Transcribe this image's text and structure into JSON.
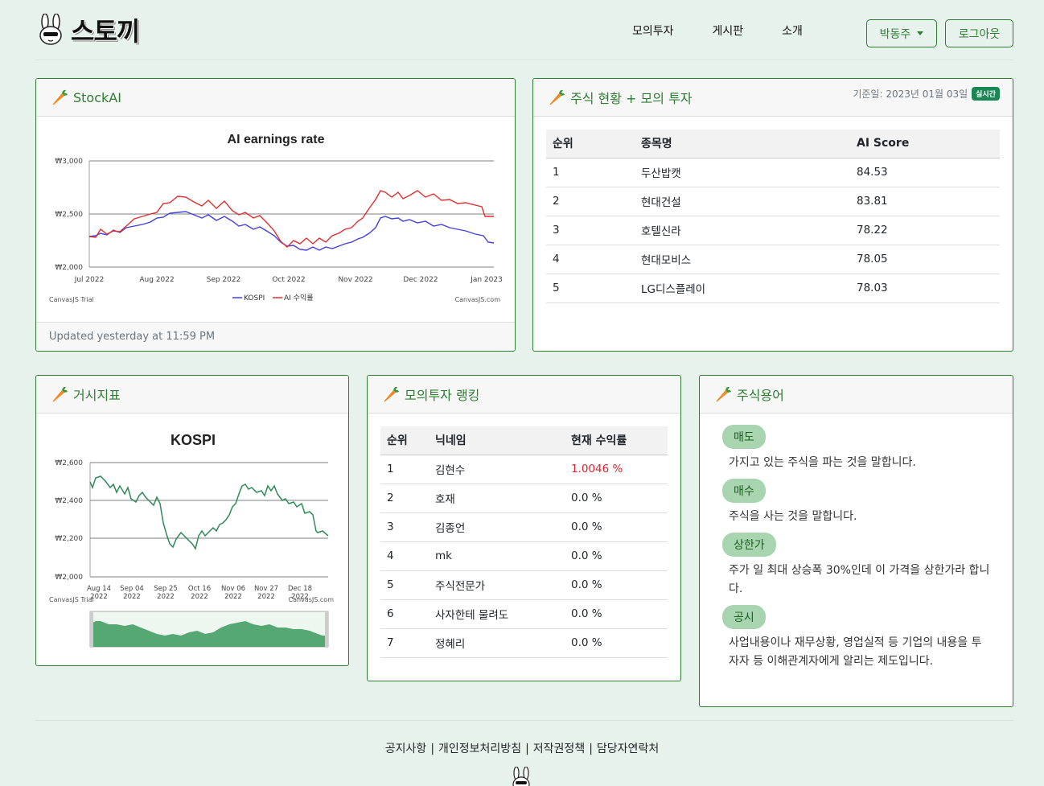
{
  "brand": {
    "name": "스토끼"
  },
  "nav": {
    "links": [
      "모의투자",
      "게시판",
      "소개"
    ],
    "user": "박동주",
    "logout": "로그아웃"
  },
  "stockai": {
    "title": "StockAI",
    "footer": "Updated yesterday at 11:59 PM",
    "chart": {
      "title": "AI earnings rate",
      "y_ticks": [
        "₩3,000",
        "₩2,500",
        "₩2,000"
      ],
      "x_ticks": [
        "Jul 2022",
        "Aug 2022",
        "Sep 2022",
        "Oct 2022",
        "Nov 2022",
        "Dec 2022",
        "Jan 2023"
      ],
      "legend": [
        "KOSPI",
        "AI 수익률"
      ],
      "credit_left": "CanvasJS Trial",
      "credit_right": "CanvasJS.com"
    }
  },
  "stocks": {
    "title": "주식 현황 + 모의 투자",
    "basis": "기준일: 2023년 01월 03일",
    "badge": "실시간",
    "headers": [
      "순위",
      "종목명",
      "AI Score"
    ],
    "rows": [
      [
        "1",
        "두산밥캣",
        "84.53"
      ],
      [
        "2",
        "현대건설",
        "83.81"
      ],
      [
        "3",
        "호텔신라",
        "78.22"
      ],
      [
        "4",
        "현대모비스",
        "78.05"
      ],
      [
        "5",
        "LG디스플레이",
        "78.03"
      ]
    ]
  },
  "macro": {
    "title": "거시지표",
    "chart": {
      "title": "KOSPI",
      "y_ticks": [
        "₩2,600",
        "₩2,400",
        "₩2,200",
        "₩2,000"
      ],
      "x_ticks": [
        [
          "Aug 14",
          "2022"
        ],
        [
          "Sep 04",
          "2022"
        ],
        [
          "Sep 25",
          "2022"
        ],
        [
          "Oct 16",
          "2022"
        ],
        [
          "Nov 06",
          "2022"
        ],
        [
          "Nov 27",
          "2022"
        ],
        [
          "Dec 18",
          "2022"
        ]
      ],
      "credit_left": "CanvasJS Trial",
      "credit_right": "CanvasJS.com"
    }
  },
  "ranking": {
    "title": "모의투자 랭킹",
    "headers": [
      "순위",
      "닉네임",
      "현재 수익률"
    ],
    "rows": [
      [
        "1",
        "김현수",
        "1.0046 %"
      ],
      [
        "2",
        "호재",
        "0.0 %"
      ],
      [
        "3",
        "김종언",
        "0.0 %"
      ],
      [
        "4",
        "mk",
        "0.0 %"
      ],
      [
        "5",
        "주식전문가",
        "0.0 %"
      ],
      [
        "6",
        "사자한테 물려도",
        "0.0 %"
      ],
      [
        "7",
        "정혜리",
        "0.0 %"
      ]
    ]
  },
  "terms": {
    "title": "주식용어",
    "items": [
      {
        "term": "매도",
        "desc": "가지고 있는 주식을 파는 것을 말합니다."
      },
      {
        "term": "매수",
        "desc": "주식을 사는 것을 말합니다."
      },
      {
        "term": "상한가",
        "desc": "주가 일 최대 상승폭 30%인데 이 가격을 상한가라 합니다."
      },
      {
        "term": "공시",
        "desc": "사업내용이나 재무상황, 영업실적 등 기업의 내용을 투자자 등 이해관계자에게 알리는 제도입니다."
      }
    ]
  },
  "footer": {
    "links": [
      "공지사항",
      "개인정보처리방침",
      "저작권정책",
      "담당자연락처"
    ]
  },
  "icons": {
    "carrot": "carrot-icon",
    "bunny": "bunny-logo-icon"
  },
  "colors": {
    "accent": "#2e7d32",
    "kospi_line": "#4040e0",
    "ai_line": "#e03030",
    "kospi_area": "#3a9a5a"
  }
}
